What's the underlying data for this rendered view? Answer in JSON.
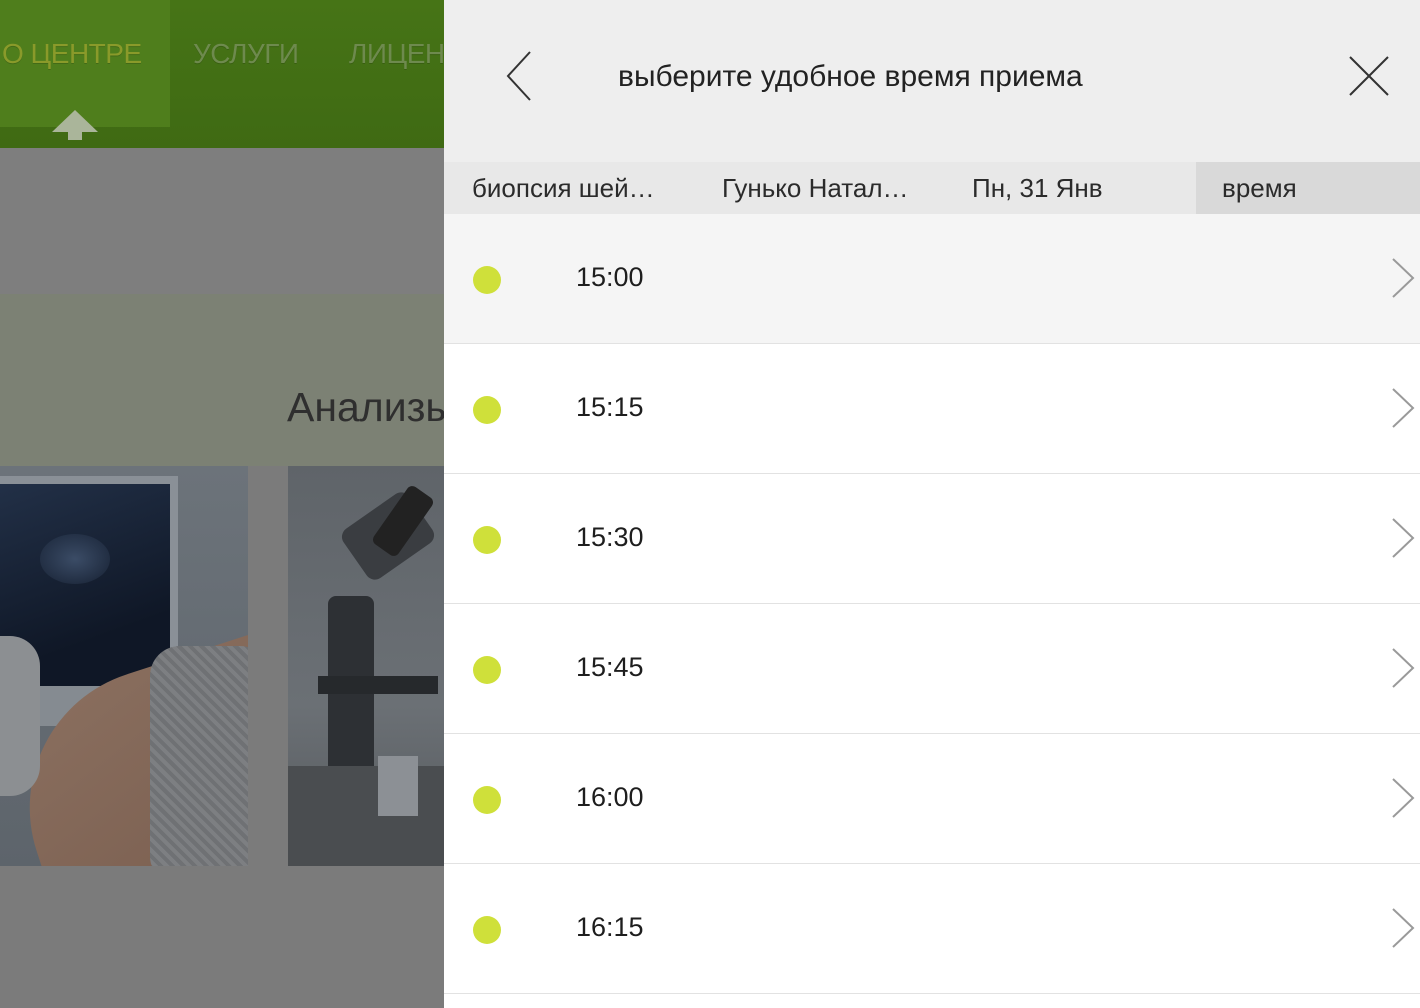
{
  "background": {
    "nav_items": [
      {
        "label": "О ЦЕНТРЕ",
        "active": true
      },
      {
        "label": "УСЛУГИ",
        "active": false
      },
      {
        "label": "ЛИЦЕН",
        "active": false
      }
    ],
    "section_heading": "Анализы"
  },
  "modal": {
    "title": "выберите удобное время приема",
    "back_icon": "chevron-left-icon",
    "close_icon": "close-icon",
    "breadcrumbs": [
      {
        "label": "биопсия шей…",
        "active": false
      },
      {
        "label": "Гунько Натал…",
        "active": false
      },
      {
        "label": "Пн, 31 Янв",
        "active": false
      },
      {
        "label": "время",
        "active": true
      }
    ],
    "slots": [
      {
        "time": "15:00"
      },
      {
        "time": "15:15"
      },
      {
        "time": "15:30"
      },
      {
        "time": "15:45"
      },
      {
        "time": "16:00"
      },
      {
        "time": "16:15"
      }
    ],
    "slot_status_color": "#cfe03a",
    "chevron_icon": "chevron-right-icon"
  },
  "colors": {
    "nav_green": "#467416",
    "accent_lime": "#cfe03a"
  }
}
